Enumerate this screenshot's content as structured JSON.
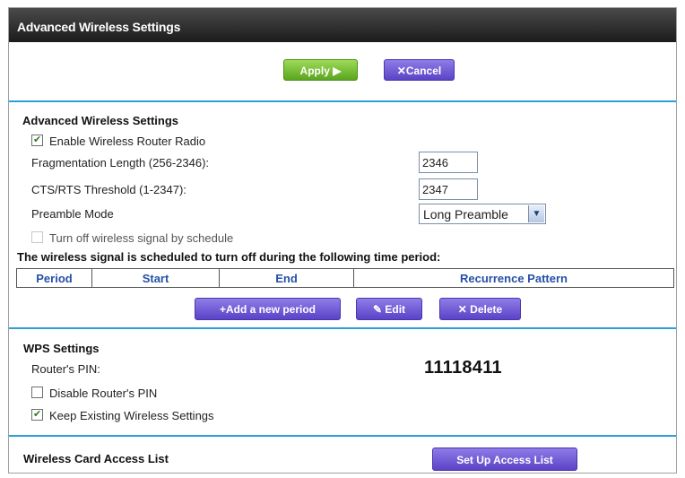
{
  "window": {
    "title": "Advanced Wireless Settings"
  },
  "actions": {
    "apply_label": "Apply ▶",
    "cancel_label": "✕Cancel"
  },
  "advanced": {
    "heading": "Advanced Wireless Settings",
    "enable_radio": {
      "label": "Enable Wireless Router Radio",
      "checked": true
    },
    "frag_length": {
      "label": "Fragmentation Length (256-2346):",
      "value": "2346"
    },
    "cts_rts": {
      "label": "CTS/RTS Threshold (1-2347):",
      "value": "2347"
    },
    "preamble": {
      "label": "Preamble Mode",
      "selected": "Long Preamble"
    },
    "schedule_toggle": {
      "label": "Turn off wireless signal by schedule",
      "checked": false
    },
    "schedule_note": "The wireless signal is scheduled to turn off during the following time period:",
    "schedule_table": {
      "columns": [
        "Period",
        "Start",
        "End",
        "Recurrence Pattern"
      ]
    },
    "add_period_label": "+Add a new period",
    "edit_label": "Edit",
    "delete_label": "✕ Delete"
  },
  "wps": {
    "heading": "WPS Settings",
    "pin_label": "Router's PIN:",
    "pin_value": "11118411",
    "disable_pin": {
      "label": "Disable Router's PIN",
      "checked": false
    },
    "keep_existing": {
      "label": "Keep Existing Wireless Settings",
      "checked": true
    }
  },
  "access_list": {
    "heading": "Wireless Card Access List",
    "button_label": "Set Up Access List"
  },
  "colors": {
    "title_bar": "#2a2a2a",
    "divider": "#2aa0d8",
    "apply_green": "#6bb82a",
    "action_purple": "#6a55d2",
    "table_header_text": "#2550a8"
  }
}
